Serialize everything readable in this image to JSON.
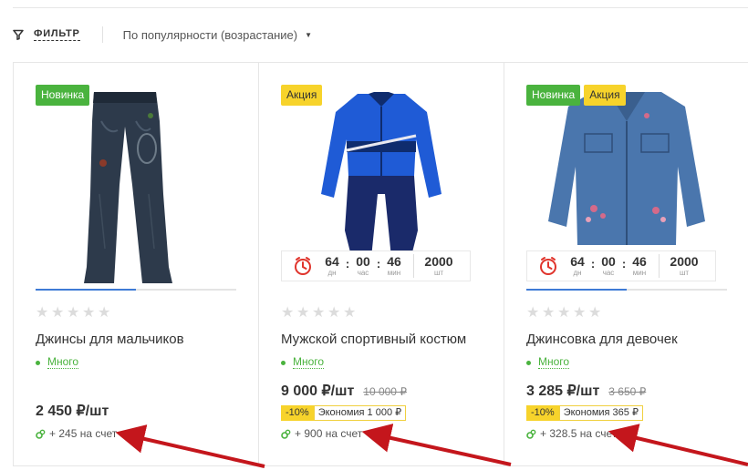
{
  "toolbar": {
    "filter_label": "ФИЛЬТР",
    "sort_value": "По популярности (возрастание)"
  },
  "products": [
    {
      "badges": [
        "Новинка"
      ],
      "title": "Джинсы для мальчиков",
      "stock": "Много",
      "price": "2 450 ₽/шт",
      "bonus": "+ 245 на счет"
    },
    {
      "badges": [
        "Акция"
      ],
      "timer": {
        "d": "64",
        "d_unit": "дн",
        "h": "00",
        "h_unit": "час",
        "m": "46",
        "m_unit": "мин",
        "qty": "2000",
        "qty_unit": "шт"
      },
      "title": "Мужской спортивный костюм",
      "stock": "Много",
      "price": "9 000 ₽/шт",
      "old_price": "10 000 ₽",
      "discount": "-10%",
      "savings": "Экономия 1 000 ₽",
      "bonus": "+ 900 на счет"
    },
    {
      "badges": [
        "Новинка",
        "Акция"
      ],
      "timer": {
        "d": "64",
        "d_unit": "дн",
        "h": "00",
        "h_unit": "час",
        "m": "46",
        "m_unit": "мин",
        "qty": "2000",
        "qty_unit": "шт"
      },
      "title": "Джинсовка для девочек",
      "stock": "Много",
      "price": "3 285 ₽/шт",
      "old_price": "3 650 ₽",
      "discount": "-10%",
      "savings": "Экономия 365 ₽",
      "bonus": "+ 328.5 на счет"
    }
  ],
  "colors": {
    "new_badge": "#4ab33e",
    "sale_badge": "#f7d32b",
    "accent_blue": "#3e7bd6",
    "annotation_arrow": "#c4161c"
  }
}
